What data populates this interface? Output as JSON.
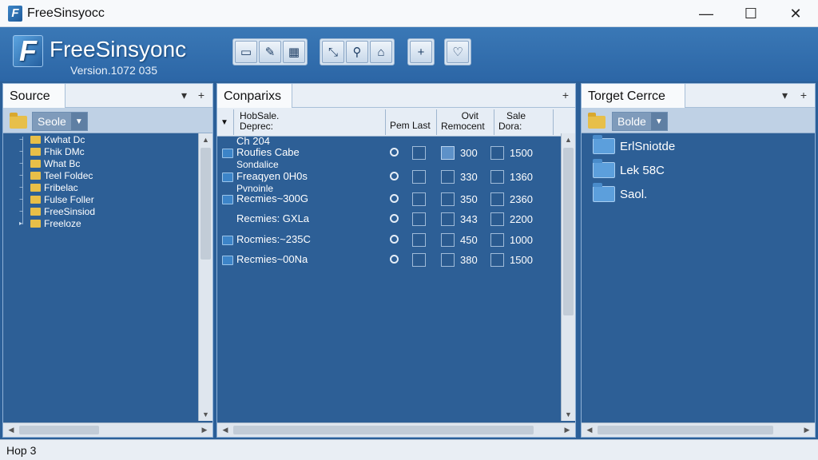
{
  "window": {
    "title": "FreeSinsyocc",
    "controls": {
      "minimize": "—",
      "maximize": "☐",
      "close": "✕"
    }
  },
  "brand": {
    "logo_letter": "F",
    "name": "FreeSinsyonc",
    "version": "Version.1072  035"
  },
  "toolbar": {
    "group1": [
      {
        "icon": "open-folder-icon",
        "glyph": "▭"
      },
      {
        "icon": "pen-icon",
        "glyph": "✎"
      },
      {
        "icon": "grid-icon",
        "glyph": "▦"
      }
    ],
    "group2": [
      {
        "icon": "resize-icon",
        "glyph": "⤡"
      },
      {
        "icon": "search-icon",
        "glyph": "⚲"
      },
      {
        "icon": "home-icon",
        "glyph": "⌂"
      }
    ],
    "group3": [
      {
        "icon": "plus-icon",
        "glyph": "+"
      }
    ],
    "group4": [
      {
        "icon": "location-icon",
        "glyph": "♡"
      }
    ]
  },
  "source": {
    "tab": "Source",
    "menu_glyph": "▾",
    "add_glyph": "+",
    "combo": "Seole",
    "tree": [
      "Kwhat Dc",
      "Fhik DMc",
      "What Bc",
      "Teel Foldec",
      "Fribelac",
      "Fulse Foller",
      "FreeSinsiod",
      "Freeloze"
    ]
  },
  "comparison": {
    "tab": "Conparixs",
    "add_glyph": "+",
    "headers": {
      "name_line1": "HobSale.",
      "name_line2": "Deprec:",
      "perm": "Pem Last",
      "ovit_line1": "Ovit",
      "ovit_line2": "Remocent",
      "sale_line1": "Sale",
      "sale_line2": "Dora:"
    },
    "top_label": "Ch 204",
    "rows": [
      {
        "name": "Roufies Cabe",
        "sub": "Sondalice",
        "val1": "300",
        "val2": "1500"
      },
      {
        "name": "Freaqyen 0H0s",
        "sub": "Pvnoinle",
        "val1": "330",
        "val2": "1360"
      },
      {
        "name": "Recmies~300G",
        "sub": "",
        "val1": "350",
        "val2": "2360"
      },
      {
        "name": "Recmies: GXLa",
        "sub": "",
        "val1": "343",
        "val2": "2200"
      },
      {
        "name": "Rocmies:~235C",
        "sub": "",
        "val1": "450",
        "val2": "1000"
      },
      {
        "name": "Recmies~00Na",
        "sub": "",
        "val1": "380",
        "val2": "1500"
      }
    ]
  },
  "target": {
    "tab": "Torget Cerrce",
    "menu_glyph": "▾",
    "add_glyph": "+",
    "combo": "Bolde",
    "items": [
      "ErlSniotde",
      "Lek 58C",
      "Saol."
    ]
  },
  "status": {
    "text": "Hop 3"
  }
}
